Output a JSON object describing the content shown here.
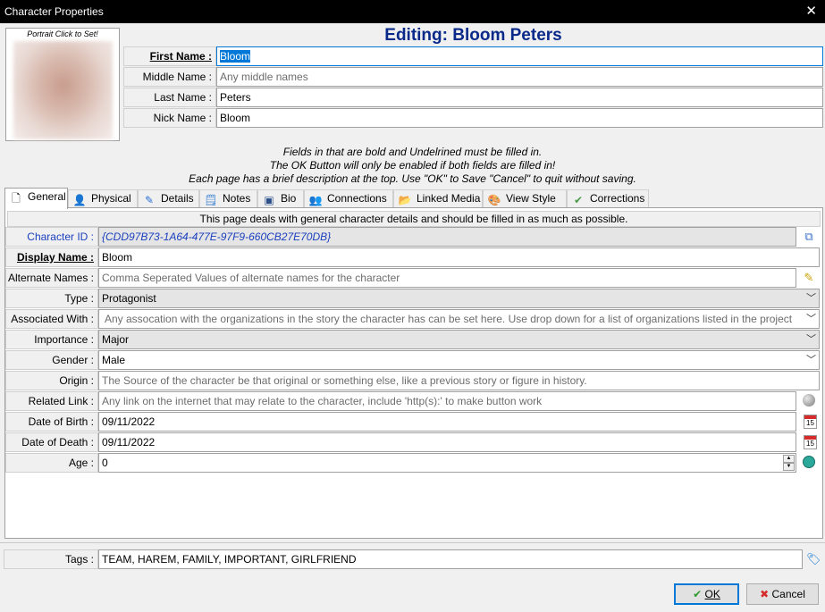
{
  "window": {
    "title": "Character Properties",
    "close_glyph": "✕"
  },
  "portrait": {
    "label": "Portrait Click to Set!"
  },
  "header": {
    "title": "Editing: Bloom Peters",
    "first_name": {
      "label": "First Name :",
      "value": "Bloom"
    },
    "middle_name": {
      "label": "Middle Name :",
      "placeholder": "Any middle names"
    },
    "last_name": {
      "label": "Last Name :",
      "value": "Peters"
    },
    "nick_name": {
      "label": "Nick Name :",
      "value": "Bloom"
    }
  },
  "info": {
    "line1": "Fields in that are bold and Undelrined must be filled in.",
    "line2": "The OK Button will only be enabled if both fields are filled in!",
    "line3": "Each page has a brief description at the top. Use \"OK\" to Save \"Cancel\" to quit without saving."
  },
  "tabs": [
    {
      "label": "General",
      "icon": "page-icon"
    },
    {
      "label": "Physical",
      "icon": "person-icon"
    },
    {
      "label": "Details",
      "icon": "pencil-icon"
    },
    {
      "label": "Notes",
      "icon": "notes-icon"
    },
    {
      "label": "Bio",
      "icon": "bio-icon"
    },
    {
      "label": "Connections",
      "icon": "connections-icon"
    },
    {
      "label": "Linked Media",
      "icon": "folder-icon"
    },
    {
      "label": "View Style",
      "icon": "palette-icon"
    },
    {
      "label": "Corrections",
      "icon": "corrections-icon"
    }
  ],
  "general": {
    "description": "This page deals with general character details and should be filled in as much as possible.",
    "character_id": {
      "label": "Character ID :",
      "value": "{CDD97B73-1A64-477E-97F9-660CB27E70DB}"
    },
    "display_name": {
      "label": "Display Name :",
      "value": "Bloom"
    },
    "alternate_names": {
      "label": "Alternate Names :",
      "placeholder": "Comma Seperated Values of alternate names for the character"
    },
    "type": {
      "label": "Type :",
      "value": "Protagonist"
    },
    "associated_with": {
      "label": "Associated With :",
      "placeholder": "Any assocation with the organizations in the story the character has can be set here. Use drop down for a list of organizations listed in the project"
    },
    "importance": {
      "label": "Importance :",
      "value": "Major"
    },
    "gender": {
      "label": "Gender :",
      "value": "Male"
    },
    "origin": {
      "label": "Origin :",
      "placeholder": "The Source of the character be that original or something else, like a previous story or figure in history."
    },
    "related_link": {
      "label": "Related Link :",
      "placeholder": "Any link on the internet that may relate to the character, include 'http(s):' to make button work"
    },
    "date_of_birth": {
      "label": "Date of Birth :",
      "value": "09/11/2022"
    },
    "date_of_death": {
      "label": "Date of Death :",
      "value": "09/11/2022"
    },
    "age": {
      "label": "Age :",
      "value": "0"
    },
    "calendar_day": "15"
  },
  "tags": {
    "label": "Tags :",
    "value": "TEAM, HAREM, FAMILY, IMPORTANT, GIRLFRIEND"
  },
  "buttons": {
    "ok": "OK",
    "cancel": "Cancel"
  },
  "colors": {
    "title_blue": "#0a2a8a",
    "id_blue": "#1a3fbf",
    "selection": "#0078d7"
  }
}
